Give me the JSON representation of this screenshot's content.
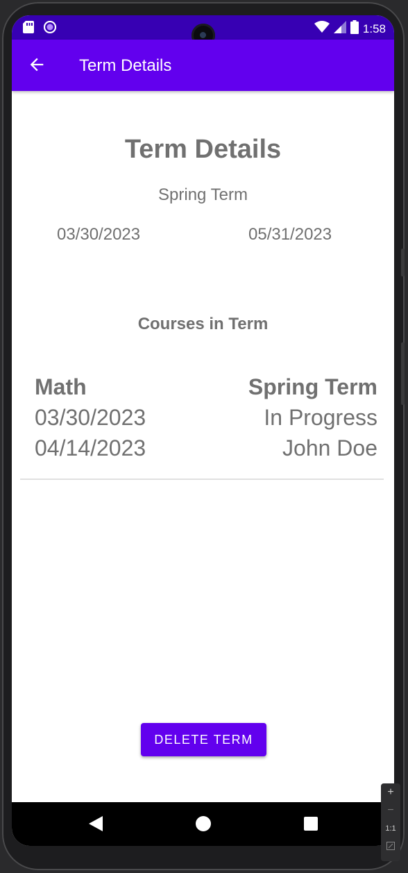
{
  "status_bar": {
    "time": "1:58"
  },
  "app_bar": {
    "title": "Term Details"
  },
  "page": {
    "heading": "Term Details",
    "term_name": "Spring Term",
    "start_date": "03/30/2023",
    "end_date": "05/31/2023",
    "courses_heading": "Courses in Term"
  },
  "courses": [
    {
      "title": "Math",
      "start": "03/30/2023",
      "end": "04/14/2023",
      "term": "Spring Term",
      "status": "In Progress",
      "instructor": "John Doe"
    }
  ],
  "actions": {
    "delete_label": "DELETE TERM"
  },
  "zoom_panel": {
    "plus": "+",
    "minus": "−",
    "ratio": "1:1"
  },
  "colors": {
    "primary": "#6200ee",
    "primary_dark": "#3700b3",
    "text_gray": "#707070"
  },
  "icons": {
    "status_left": [
      "sd-card-icon",
      "circle-notification-icon"
    ],
    "status_right": [
      "wifi-icon",
      "cell-signal-icon",
      "battery-icon"
    ],
    "app_bar": "arrow-back-icon",
    "nav": [
      "nav-back-icon",
      "nav-home-icon",
      "nav-recents-icon"
    ]
  }
}
